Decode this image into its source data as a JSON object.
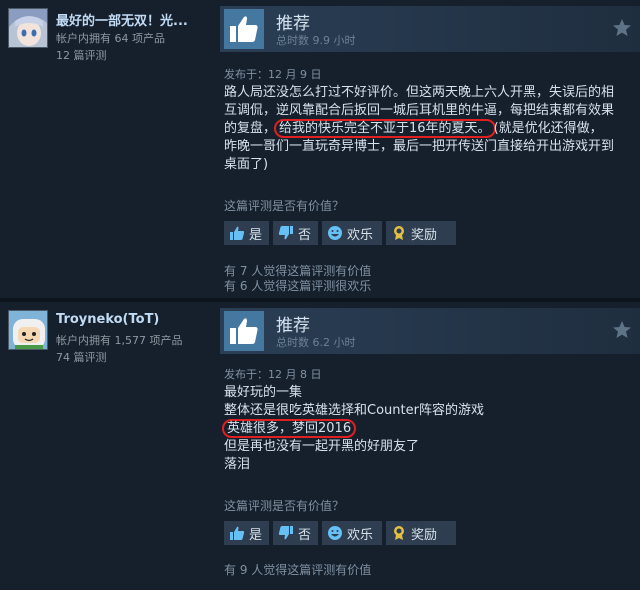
{
  "reviews": [
    {
      "username": "最好的一部无双！光...",
      "products": "帐户内拥有 64 项产品",
      "review_count": "12 篇评测",
      "vote": "推荐",
      "hours": "总时数 9.9 小时",
      "posted": "发布于：12 月 9 日",
      "text_line1": "路人局还没怎么打过不好评价。但这两天晚上六人开黑，失误后的相",
      "text_line2": "互调侃，逆风靠配合后扳回一城后耳机里的牛逼，每把结束都有效果",
      "text_line3a": "的复盘，",
      "text_line3_circled": "给我的快乐完全不亚于16年的夏天。",
      "text_line3b": "(就是优化还得做，",
      "text_line4": "昨晚一哥们一直玩奇异博士，最后一把开传送门直接给开出游戏开到",
      "text_line5": "桌面了)",
      "helpful_question": "这篇评测是否有价值？",
      "buttons": {
        "yes": "是",
        "no": "否",
        "funny": "欢乐",
        "award": "奖励"
      },
      "helpful_line1": "有 7 人觉得这篇评测有价值",
      "helpful_line2": "有 6 人觉得这篇评测很欢乐"
    },
    {
      "username": "Troyneko(ToT)",
      "products": "帐户内拥有 1,577 项产品",
      "review_count": "74 篇评测",
      "vote": "推荐",
      "hours": "总时数 6.2 小时",
      "posted": "发布于：12 月 8 日",
      "text_line1": "最好玩的一集",
      "text_line2": "整体还是很吃英雄选择和Counter阵容的游戏",
      "text_line3_circled": "英雄很多，梦回2016",
      "text_line4": "但是再也没有一起开黑的好朋友了",
      "text_line5": "落泪",
      "helpful_question": "这篇评测是否有价值？",
      "buttons": {
        "yes": "是",
        "no": "否",
        "funny": "欢乐",
        "award": "奖励"
      },
      "helpful_line1": "有 9 人觉得这篇评测有价值"
    }
  ],
  "colors": {
    "background": "#1b2838",
    "panel": "#16202d",
    "accent_blue": "#4478a0",
    "highlight_red": "#e02020",
    "username": "#c1dbf4"
  },
  "icons": {
    "thumbs_up": "thumbs-up-icon",
    "thumbs_down": "thumbs-down-icon",
    "laugh": "laugh-icon",
    "award": "award-icon",
    "star": "award-star-icon"
  }
}
